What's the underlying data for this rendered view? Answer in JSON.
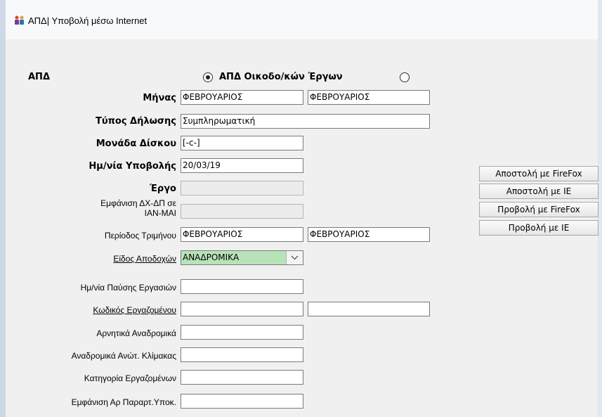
{
  "window": {
    "title": "ΑΠΔ| Υποβολή μέσω Internet"
  },
  "form": {
    "apd_label": "ΑΠΔ",
    "radio_apd_label": "ΑΠΔ Οικοδο/κών Έργων",
    "month": {
      "label": "Μήνας",
      "from": "ΦΕΒΡΟΥΑΡΙΟΣ",
      "to": "ΦΕΒΡΟΥΑΡΙΟΣ"
    },
    "declaration_type": {
      "label": "Τύπος Δήλωσης",
      "value": "Συμπληρωματική"
    },
    "disk_unit": {
      "label": "Μονάδα Δίσκου",
      "value": "[-c-]"
    },
    "submission_date": {
      "label": "Ημ/νία Υποβολής",
      "value": "20/03/19"
    },
    "project": {
      "label": "Έργο",
      "value": ""
    },
    "show_dxdp": {
      "label_line1": "Εμφάνιση ΔΧ-ΔΠ σε",
      "label_line2": "ΙΑΝ-ΜΑΙ",
      "value": ""
    },
    "quarter_period": {
      "label": "Περίοδος Τριμήνου",
      "from": "ΦΕΒΡΟΥΑΡΙΟΣ",
      "to": "ΦΕΒΡΟΥΑΡΙΟΣ"
    },
    "earnings_type": {
      "label": "Είδος Αποδοχών",
      "value": "ΑΝΑΔΡΟΜΙΚΑ"
    },
    "work_stop_date": {
      "label": "Ημ/νία Παύσης Εργασιών",
      "value": ""
    },
    "employee_code": {
      "label": "Κωδικός Εργαζομένου",
      "from": "",
      "to": ""
    },
    "negative_retro": {
      "label": "Αρνητικά Αναδρομικά",
      "value": ""
    },
    "retro_higher_scale": {
      "label": "Αναδρομικά Ανώτ. Κλίμακας",
      "value": ""
    },
    "employee_category": {
      "label": "Κατηγορία Εργαζομένων",
      "value": ""
    },
    "show_annex_number": {
      "label": "Εμφάνιση Αρ Παραρτ.Υποκ.",
      "value": ""
    }
  },
  "actions": {
    "send_firefox": "Αποστολή με FireFox",
    "send_ie": "Αποστολή με IE",
    "view_firefox": "Προβολή με FireFox",
    "view_ie": "Προβολή με IE"
  }
}
